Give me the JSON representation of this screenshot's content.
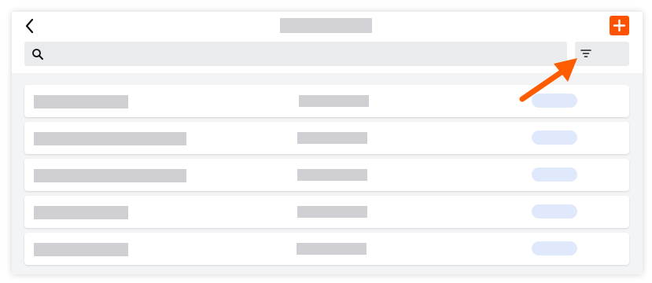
{
  "header": {
    "back_icon": "chevron-left-icon",
    "add_icon": "plus-icon",
    "title": ""
  },
  "search": {
    "icon": "search-icon",
    "placeholder": "",
    "value": ""
  },
  "filter": {
    "icon": "filter-icon",
    "label": ""
  },
  "list": {
    "items": [
      {
        "name": "",
        "detail": "",
        "status": ""
      },
      {
        "name": "",
        "detail": "",
        "status": ""
      },
      {
        "name": "",
        "detail": "",
        "status": ""
      },
      {
        "name": "",
        "detail": "",
        "status": ""
      },
      {
        "name": "",
        "detail": "",
        "status": ""
      }
    ]
  },
  "colors": {
    "accent": "#ff5200",
    "annotation_arrow": "#ff5c00",
    "placeholder_bar": "#d1d1d6",
    "status_pill": "#e0e9fb",
    "page_background": "#f3f4f6"
  }
}
